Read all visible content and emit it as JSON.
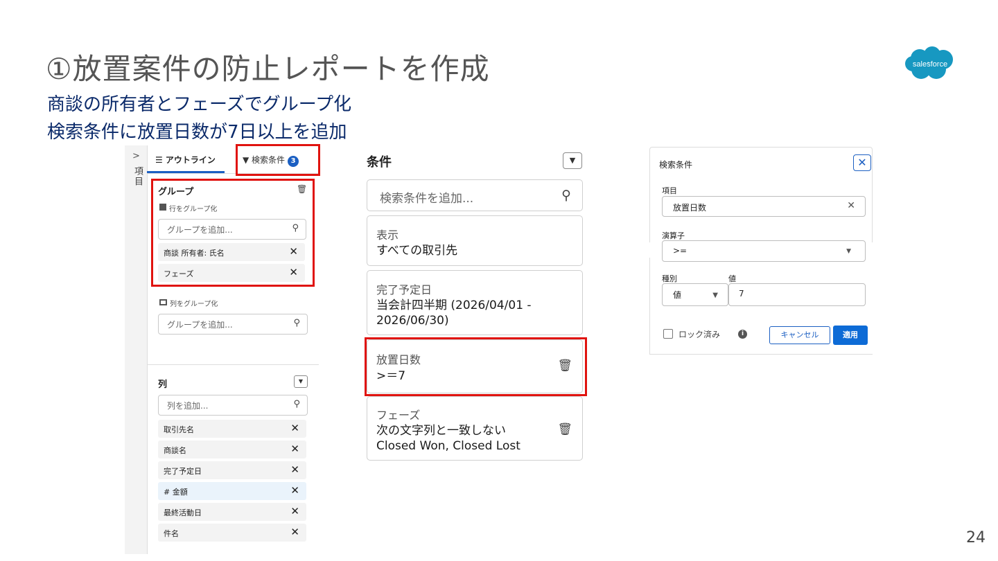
{
  "slide": {
    "title": "①放置案件の防止レポートを作成",
    "subtitle_1": "商談の所有者とフェーズでグループ化",
    "subtitle_2": "検索条件に放置日数が7日以上を追加",
    "logo_text": "salesforce",
    "page_number": "24"
  },
  "outline_panel": {
    "rail_chevron": ">",
    "rail_label": "項目",
    "tab_outline_label": "☰ アウトライン",
    "tab_filter_label": "▼ 検索条件",
    "tab_filter_count": "3",
    "group_section_title": "グループ",
    "row_group_label": "行をグループ化",
    "row_group_placeholder": "グループを追加...",
    "row_groups": [
      "商談 所有者: 氏名",
      "フェーズ"
    ],
    "column_group_label": "列をグループ化",
    "column_group_placeholder": "グループを追加...",
    "columns_title": "列",
    "columns_placeholder": "列を追加...",
    "columns": [
      "取引先名",
      "商談名",
      "完了予定日",
      "# 金額",
      "最終活動日",
      "件名"
    ]
  },
  "filters_panel": {
    "title": "条件",
    "search_placeholder": "検索条件を追加...",
    "cards": [
      {
        "label": "表示",
        "value": "すべての取引先"
      },
      {
        "label": "完了予定日",
        "value_line1": "当会計四半期 (2026/04/01 -",
        "value_line2": "2026/06/30)"
      },
      {
        "label": "放置日数",
        "value": ">＝7"
      },
      {
        "label": "フェーズ",
        "value_line1": "次の文字列と一致しない",
        "value_line2": "Closed Won, Closed Lost"
      }
    ]
  },
  "filter_editor": {
    "title": "検索条件",
    "field_label": "項目",
    "field_value": "放置日数",
    "operator_label": "演算子",
    "operator_value": ">=",
    "type_label": "種別",
    "type_value": "値",
    "value_label": "値",
    "value_value": "7",
    "locked_label": "ロック済み",
    "cancel_label": "キャンセル",
    "apply_label": "適用"
  },
  "colors": {
    "highlight": "#e0130f",
    "brand_blue": "#0d6bd6",
    "logo_blue": "#1798c1"
  }
}
